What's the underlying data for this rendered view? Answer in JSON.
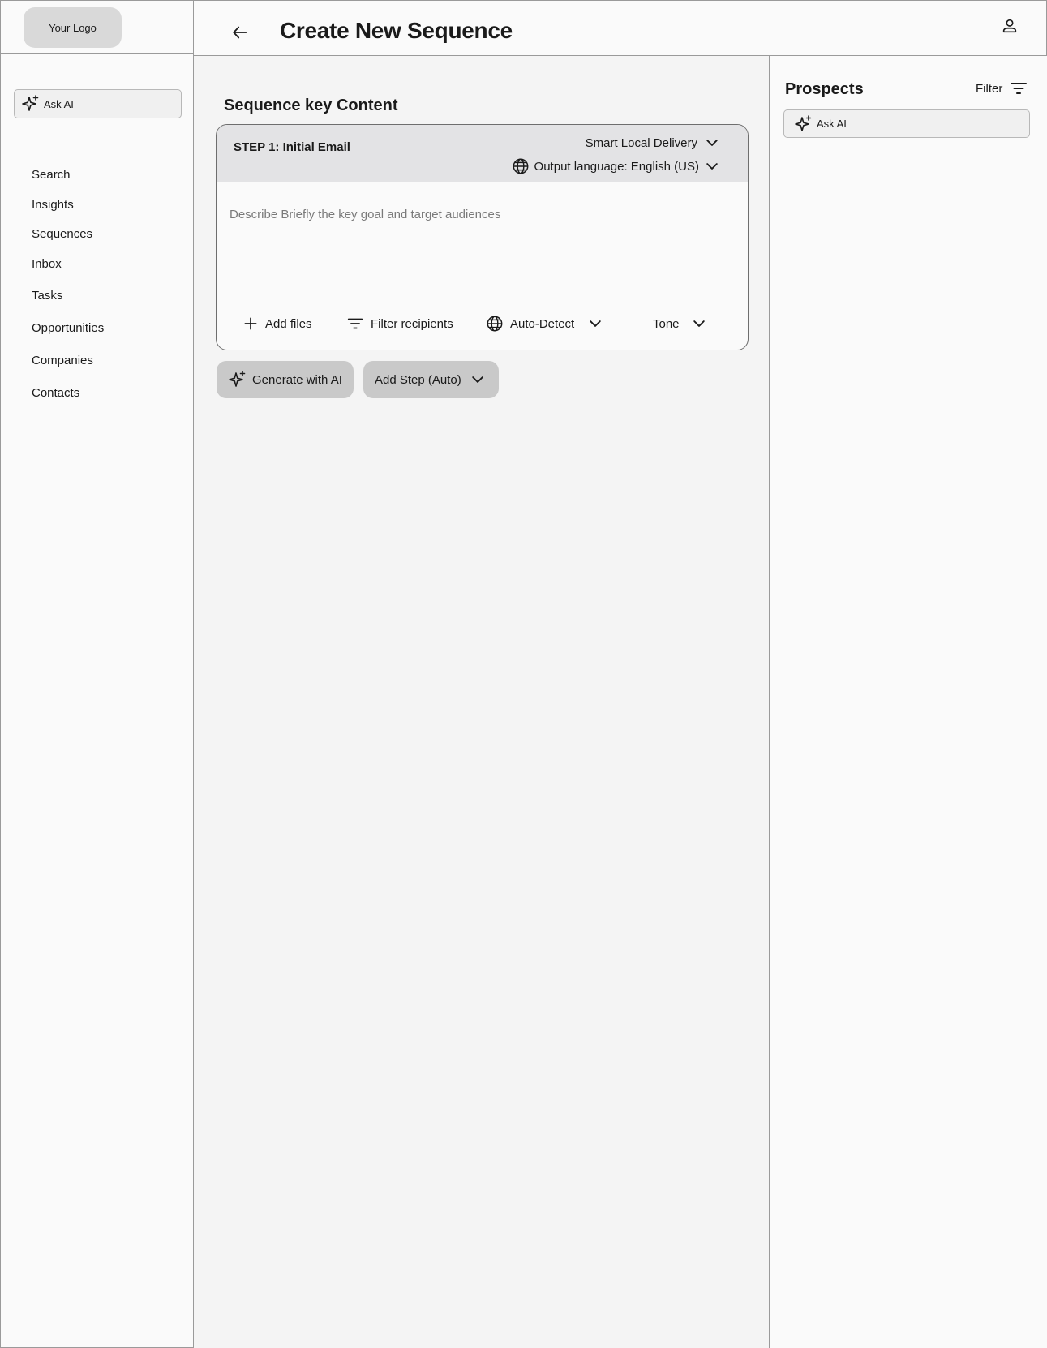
{
  "sidebar": {
    "logo": "Your Logo",
    "ask_ai": "Ask AI",
    "nav": [
      {
        "id": "search",
        "label": "Search"
      },
      {
        "id": "insights",
        "label": "Insights"
      },
      {
        "id": "sequences",
        "label": "Sequences"
      },
      {
        "id": "inbox",
        "label": "Inbox"
      },
      {
        "id": "tasks",
        "label": "Tasks"
      },
      {
        "id": "opportunities",
        "label": "Opportunities"
      },
      {
        "id": "companies",
        "label": "Companies"
      },
      {
        "id": "contacts",
        "label": "Contacts"
      }
    ]
  },
  "header": {
    "title": "Create New Sequence",
    "back_icon": "arrow-left-icon",
    "user_icon": "user-icon"
  },
  "main": {
    "section_title": "Sequence key Content",
    "step": {
      "label": "STEP 1: Initial Email",
      "delivery": "Smart Local Delivery",
      "language": "Output language: English (US)",
      "description_placeholder": "Describe Briefly the key goal and target audiences",
      "description_value": "",
      "tools": {
        "add_files": "Add files",
        "filter_recipients": "Filter recipients",
        "auto_detect": "Auto-Detect",
        "tone": "Tone"
      }
    },
    "actions": {
      "generate": "Generate with AI",
      "add_step": "Add Step (Auto)"
    }
  },
  "panel": {
    "title": "Prospects",
    "filter": "Filter",
    "ask_ai": "Ask AI"
  },
  "colors": {
    "page_bg": "#fafafa",
    "main_bg": "#f4f4f4",
    "card_head_bg": "#e3e3e5",
    "button_bg": "#c9c9c9",
    "logo_bg": "#d9d9d9",
    "border": "#9a9a9a"
  }
}
